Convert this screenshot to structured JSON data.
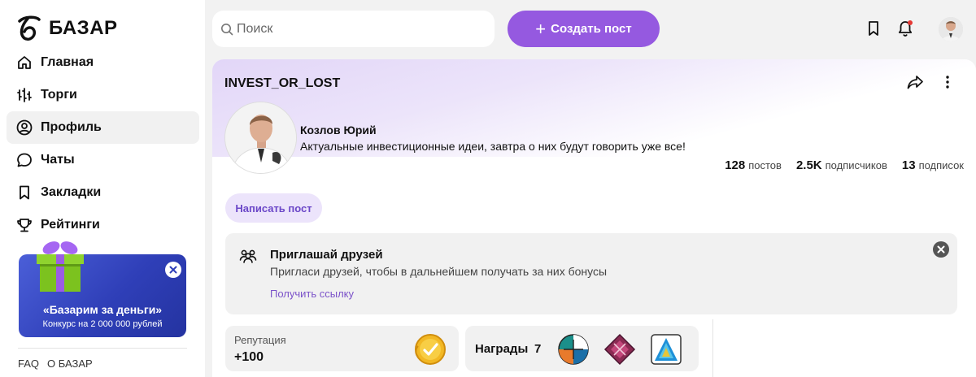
{
  "brand": {
    "name": "БАЗАР"
  },
  "nav": [
    {
      "label": "Главная",
      "icon": "home-icon"
    },
    {
      "label": "Торги",
      "icon": "trading-icon"
    },
    {
      "label": "Профиль",
      "icon": "profile-icon",
      "active": true
    },
    {
      "label": "Чаты",
      "icon": "chat-icon"
    },
    {
      "label": "Закладки",
      "icon": "bookmark-icon"
    },
    {
      "label": "Рейтинги",
      "icon": "trophy-icon"
    }
  ],
  "promo": {
    "title": "«Базарим за деньги»",
    "subtitle": "Конкурс на 2 000 000 рублей"
  },
  "footer": {
    "faq": "FAQ",
    "about": "О БАЗАР"
  },
  "header": {
    "search_placeholder": "Поиск",
    "create_label": "Создать пост",
    "accent": "#9559e0"
  },
  "profile": {
    "username": "INVEST_OR_LOST",
    "name": "Козлов Юрий",
    "bio": "Актуальные инвестиционные идеи, завтра о них будут говорить уже все!",
    "stats": {
      "posts_num": "128",
      "posts_lbl": "постов",
      "subscribers_num": "2.5K",
      "subscribers_lbl": "подписчиков",
      "subscriptions_num": "13",
      "subscriptions_lbl": "подписок"
    },
    "write_post_label": "Написать пост"
  },
  "invite": {
    "title": "Приглашай друзей",
    "text": "Пригласи друзей, чтобы в дальнейшем получать за них бонусы",
    "link": "Получить ссылку"
  },
  "reputation": {
    "label": "Репутация",
    "value": "+100"
  },
  "awards": {
    "label": "Награды",
    "count": "7"
  }
}
